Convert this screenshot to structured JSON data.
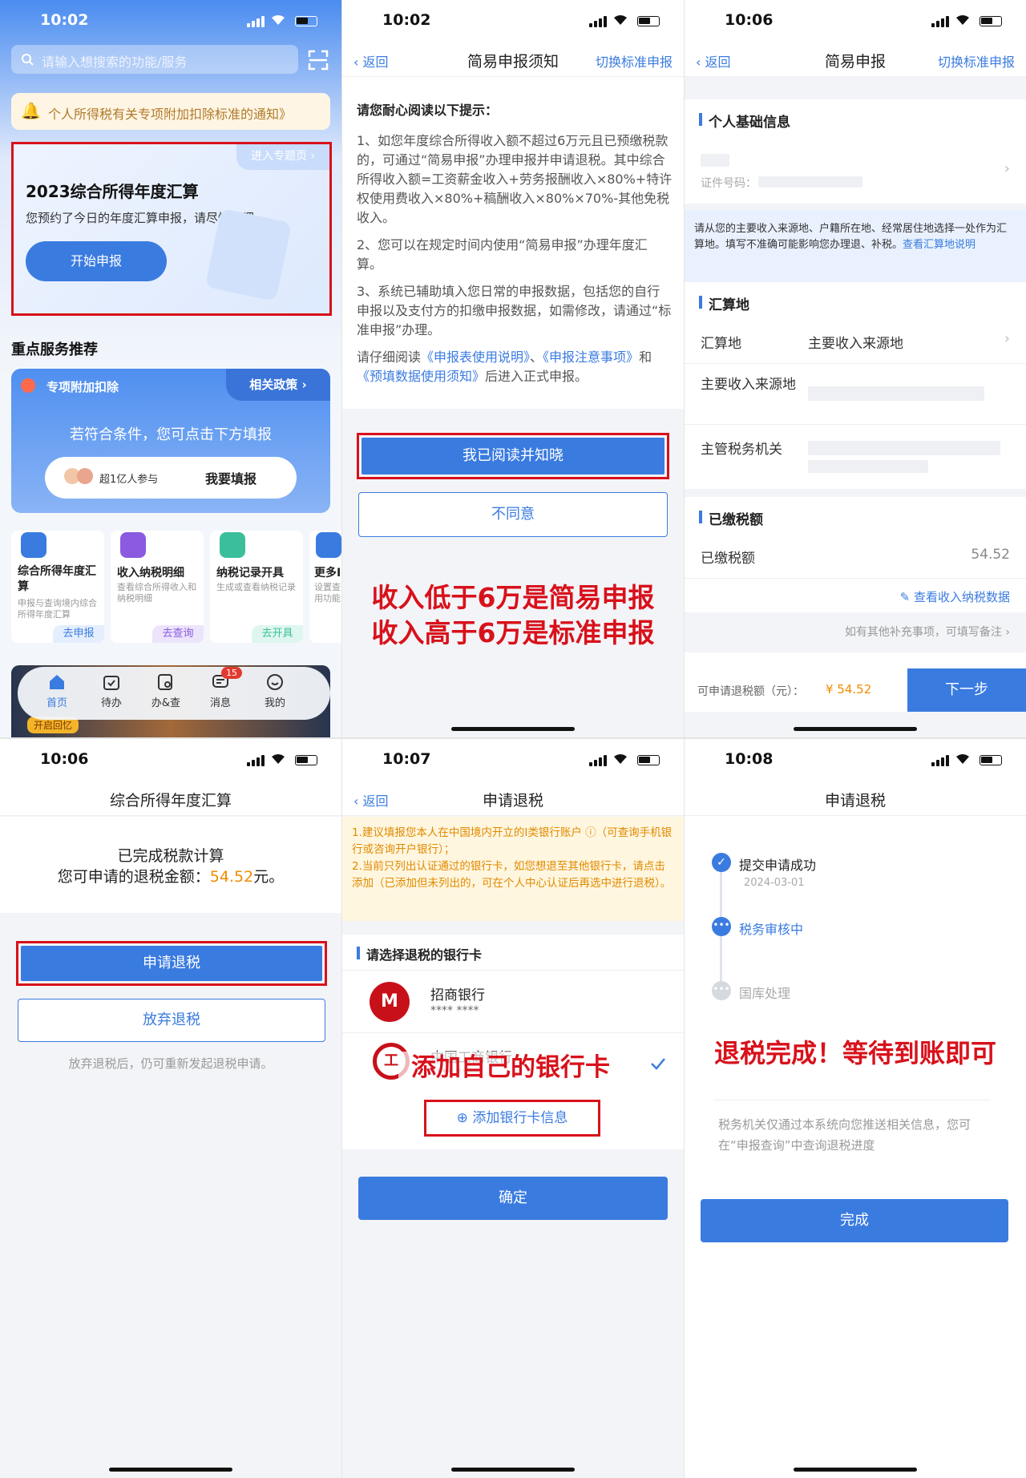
{
  "p1": {
    "time": "10:02",
    "search_placeholder": "请输入想搜索的功能/服务",
    "notice": "个人所得税有关专项附加扣除标准的通知》",
    "topic_link": "进入专题页 ›",
    "card_title": "2023综合所得年度汇算",
    "card_sub": "您预约了今日的年度汇算申报，请尽快办理",
    "start_btn": "开始申报",
    "section_title": "重点服务推荐",
    "special_label": "专项附加扣除",
    "policy": "相关政策 ›",
    "special_hint": "若符合条件，您可点击下方填报",
    "people": "超1亿人参与",
    "fill_btn": "我要填报",
    "services": [
      {
        "title": "综合所得年度汇算",
        "desc": "申报与查询境内综合所得年度汇算",
        "action": "去申报"
      },
      {
        "title": "收入纳税明细",
        "desc": "查看综合所得收入和纳税明细",
        "action": "去查询"
      },
      {
        "title": "纳税记录开具",
        "desc": "生成或查看纳税记录",
        "action": "去开具"
      },
      {
        "title": "更多I",
        "desc": "设置查用功能",
        "action": ""
      }
    ],
    "banner": "开启回忆",
    "tabs": [
      "首页",
      "待办",
      "办&查",
      "消息",
      "我的"
    ],
    "badge": "15"
  },
  "p2": {
    "time": "10:02",
    "back": "返回",
    "title": "简易申报须知",
    "switch": "切换标准申报",
    "lead": "请您耐心阅读以下提示：",
    "para1": "1、如您年度综合所得收入额不超过6万元且已预缴税款的，可通过“简易申报”办理申报并申请退税。其中综合所得收入额=工资薪金收入+劳务报酬收入×80%+特许权使用费收入×80%+稿酬收入×80%×70%-其他免税收入。",
    "para2": "2、您可以在规定时间内使用“简易申报”办理年度汇算。",
    "para3": "3、系统已辅助填入您日常的申报数据，包括您的自行申报以及支付方的扣缴申报数据，如需修改，请通过“标准申报”办理。",
    "para4_a": "请仔细阅读",
    "link1": "《申报表使用说明》",
    "para4_b": "、",
    "link2": "《申报注意事项》",
    "para4_c": "和",
    "link3": "《预填数据使用须知》",
    "para4_d": "后进入正式申报。",
    "agree": "我已阅读并知晓",
    "disagree": "不同意",
    "note1": "收入低于6万是简易申报",
    "note2": "收入高于6万是标准申报"
  },
  "p3": {
    "time": "10:06",
    "back": "返回",
    "title": "简易申报",
    "switch": "切换标准申报",
    "sec1": "个人基础信息",
    "id_label": "证件号码：",
    "info": "请从您的主要收入来源地、户籍所在地、经常居住地选择一处作为汇算地。填写不准确可能影响您办理退、补税。",
    "info_link": "查看汇算地说明",
    "sec2": "汇算地",
    "place_k": "汇算地",
    "place_v": "主要收入来源地",
    "src_k": "主要收入来源地",
    "auth_k": "主管税务机关",
    "sec3": "已缴税额",
    "paid_k": "已缴税额",
    "paid_v": "54.52",
    "view_data": "查看收入纳税数据",
    "remark": "如有其他补充事项，可填写备注 ›",
    "refund_label": "可申请退税额（元）：",
    "refund_v": "¥ 54.52",
    "next": "下一步"
  },
  "p4": {
    "time": "10:06",
    "title": "综合所得年度汇算",
    "done": "已完成税款计算",
    "amount_a": "您可申请的退税金额：",
    "amount_v": "54.52",
    "amount_b": "元。",
    "apply": "申请退税",
    "give_up": "放弃退税",
    "hint": "放弃退税后，仍可重新发起退税申请。"
  },
  "p5": {
    "time": "10:07",
    "back": "返回",
    "title": "申请退税",
    "warn1": "1.建议填报您本人在中国境内开立的Ⅰ类银行账户 ⓘ（可查询手机银行或咨询开户银行）；",
    "warn2": "2.当前只列出认证通过的银行卡，如您想退至其他银行卡，请点击添加（已添加但未列出的，可在个人中心认证后再选中进行退税）。",
    "sec": "请选择退税的银行卡",
    "bank1": "招商银行",
    "bank2": "中国工商银行",
    "mask": "**** ****",
    "note": "添加自己的银行卡",
    "add": "⊕ 添加银行卡信息",
    "confirm": "确定"
  },
  "p6": {
    "time": "10:08",
    "title": "申请退税",
    "step1": "提交申请成功",
    "step1_date": "2024-03-01",
    "step2": "税务审核中",
    "step3": "国库处理",
    "note": "退税完成！等待到账即可",
    "info": "税务机关仅通过本系统向您推送相关信息，您可在“申报查询”中查询退税进度",
    "finish": "完成"
  },
  "colors": {
    "accent": "#3a7be0",
    "annotation": "#d8111b",
    "amount": "#f08c00"
  }
}
